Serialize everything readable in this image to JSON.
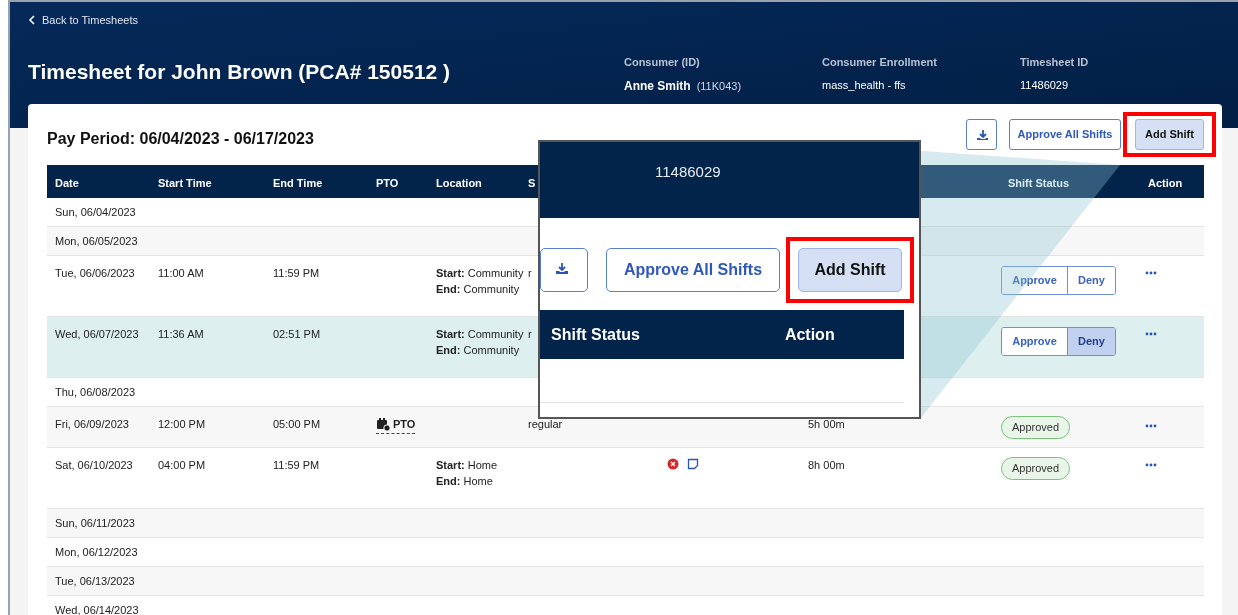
{
  "header": {
    "back_link": "Back to Timesheets",
    "title": "Timesheet for John Brown (PCA# 150512 )",
    "info": [
      {
        "label": "Consumer (ID)",
        "value": "Anne Smith",
        "extra": "(11K043)"
      },
      {
        "label": "Consumer Enrollment",
        "value": "mass_health - ffs"
      },
      {
        "label": "Timesheet ID",
        "value": "11486029"
      }
    ]
  },
  "card": {
    "pay_period": "Pay Period: 06/04/2023 - 06/17/2023",
    "buttons": [
      {
        "kind": "download"
      },
      {
        "kind": "outline",
        "label": "Approve All Shifts"
      },
      {
        "kind": "primary",
        "label": "Add Shift",
        "highlighted": true
      }
    ]
  },
  "table": {
    "columns": [
      "Date",
      "Start Time",
      "End Time",
      "PTO",
      "Location",
      "S",
      "",
      "",
      "Shift Status",
      "Action"
    ],
    "rows": [
      {
        "date": "Sun, 06/04/2023",
        "selected": false
      },
      {
        "date": "Mon, 06/05/2023",
        "selected": false
      },
      {
        "date": "Tue, 06/06/2023",
        "start": "11:00 AM",
        "end": "11:59 PM",
        "location": [
          "**Start:** Community",
          "**End:** Community"
        ],
        "column_6": "r",
        "status": {
          "kind": "decision",
          "options": [
            {
              "label": "Approve",
              "selected": false
            },
            {
              "label": "Deny",
              "selected": false
            }
          ]
        },
        "selected": false
      },
      {
        "date": "Wed, 06/07/2023",
        "start": "11:36 AM",
        "end": "02:51 PM",
        "location": [
          "**Start:** Community",
          "**End:** Community"
        ],
        "column_6": "r",
        "status": {
          "kind": "decision",
          "options": [
            {
              "label": "Approve",
              "selected": false
            },
            {
              "label": "Deny",
              "selected": true
            }
          ]
        },
        "selected": true
      },
      {
        "date": "Thu, 06/08/2023",
        "selected": false
      },
      {
        "date": "Fri, 06/09/2023",
        "start": "12:00 PM",
        "end": "05:00 PM",
        "pto": "PTO",
        "column_6": "regular",
        "hours": "5h 00m",
        "status": {
          "kind": "badge",
          "label": "Approved"
        },
        "selected": false
      },
      {
        "date": "Sat, 06/10/2023",
        "start": "04:00 PM",
        "end": "11:59 PM",
        "location": [
          "**Start:** Home",
          "**End:** Home"
        ],
        "indicators": [
          {
            "kind": "error"
          },
          {
            "kind": "note"
          }
        ],
        "hours": "8h 00m",
        "status": {
          "kind": "badge",
          "label": "Approved"
        },
        "selected": false
      },
      {
        "date": "Sun, 06/11/2023",
        "selected": false
      },
      {
        "date": "Mon, 06/12/2023",
        "selected": false
      },
      {
        "date": "Tue, 06/13/2023",
        "selected": false
      },
      {
        "date": "Wed, 06/14/2023",
        "selected": false
      }
    ]
  },
  "callout": {
    "timesheet_id": "11486029",
    "buttons": [
      {
        "kind": "download"
      },
      {
        "kind": "outline",
        "label": "Approve All Shifts"
      },
      {
        "kind": "primary",
        "label": "Add Shift",
        "highlighted": true
      }
    ],
    "columns": [
      "Shift Status",
      "Action"
    ]
  }
}
